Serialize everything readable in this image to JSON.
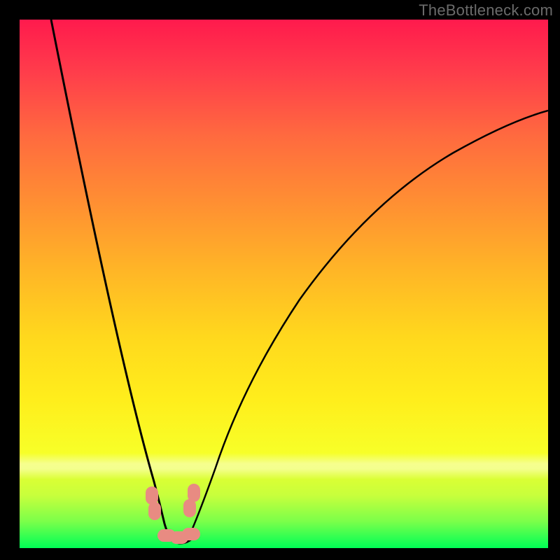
{
  "branding": {
    "text": "TheBottleneck.com"
  },
  "colors": {
    "page_bg": "#000000",
    "curve": "#000000",
    "node": "#e88b82",
    "branding_text": "#6b6b6b",
    "gradient_top": "#ff1a4d",
    "gradient_bottom": "#00ff55"
  },
  "chart_data": {
    "type": "line",
    "title": "",
    "xlabel": "",
    "ylabel": "",
    "xlim": [
      0,
      100
    ],
    "ylim": [
      0,
      100
    ],
    "grid": false,
    "legend": false,
    "annotations": [
      "TheBottleneck.com"
    ],
    "series": [
      {
        "name": "left-branch",
        "x": [
          6,
          8,
          10,
          12,
          14,
          16,
          18,
          20,
          22,
          24,
          25.5,
          27
        ],
        "y": [
          100,
          88,
          76,
          65,
          54,
          44,
          34,
          25,
          17,
          10,
          6,
          3
        ]
      },
      {
        "name": "right-branch",
        "x": [
          31,
          33,
          36,
          40,
          45,
          52,
          60,
          70,
          82,
          94,
          100
        ],
        "y": [
          3,
          7,
          14,
          24,
          35,
          47,
          57,
          66,
          74,
          79,
          82
        ]
      },
      {
        "name": "valley-floor",
        "x": [
          27,
          28,
          29,
          30,
          31
        ],
        "y": [
          3,
          1.5,
          1,
          1.5,
          3
        ]
      }
    ],
    "markers": [
      {
        "name": "left-cluster-upper",
        "x": 25.0,
        "y": 10.0
      },
      {
        "name": "left-cluster-lower",
        "x": 25.6,
        "y": 7.0
      },
      {
        "name": "right-cluster-upper",
        "x": 33.0,
        "y": 10.5
      },
      {
        "name": "right-cluster-lower",
        "x": 32.2,
        "y": 7.5
      },
      {
        "name": "floor-left",
        "x": 27.8,
        "y": 2.4
      },
      {
        "name": "floor-mid",
        "x": 30.2,
        "y": 2.0
      },
      {
        "name": "floor-right",
        "x": 32.4,
        "y": 2.6
      }
    ]
  }
}
